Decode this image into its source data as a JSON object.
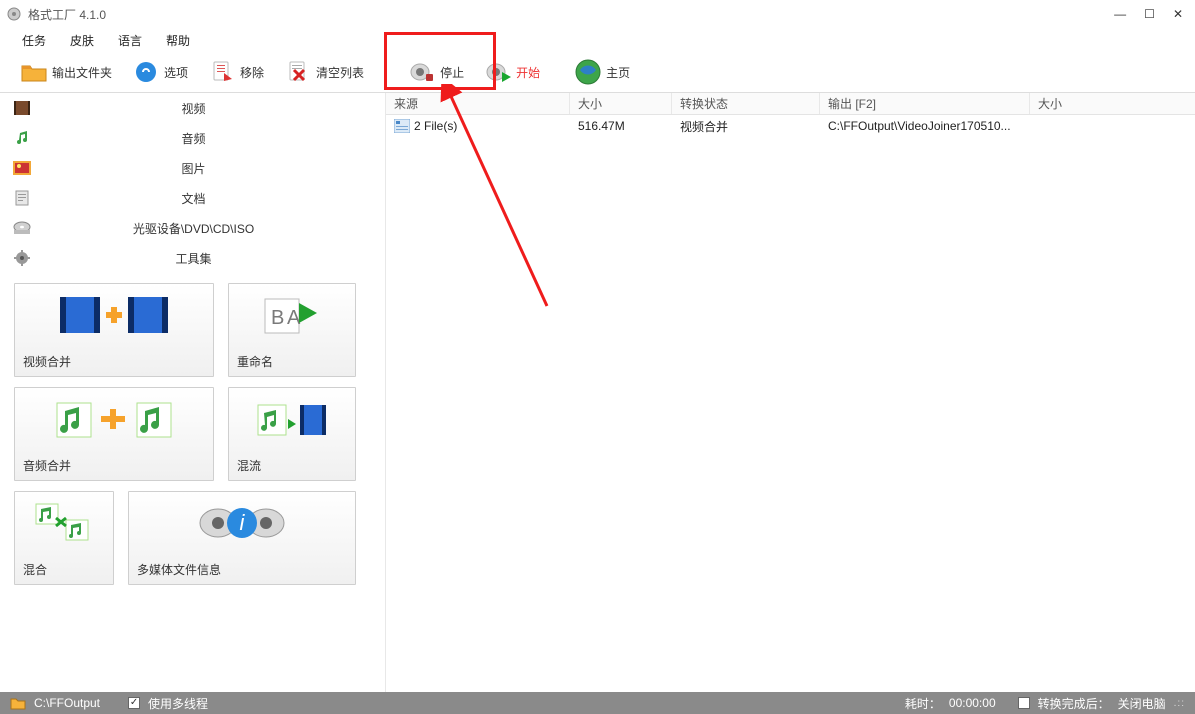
{
  "window": {
    "title": "格式工厂 4.1.0"
  },
  "menu": {
    "task": "任务",
    "skin": "皮肤",
    "lang": "语言",
    "help": "帮助"
  },
  "toolbar": {
    "output_folder": "输出文件夹",
    "options": "选项",
    "remove": "移除",
    "clear": "清空列表",
    "stop": "停止",
    "start": "开始",
    "home": "主页"
  },
  "categories": {
    "video": "视频",
    "audio": "音频",
    "picture": "图片",
    "document": "文档",
    "drive": "光驱设备\\DVD\\CD\\ISO",
    "toolkit": "工具集"
  },
  "tiles": {
    "video_join": "视频合并",
    "rename": "重命名",
    "audio_join": "音频合并",
    "mux": "混流",
    "mix": "混合",
    "media_info": "多媒体文件信息"
  },
  "table": {
    "headers": {
      "source": "来源",
      "size": "大小",
      "state": "转换状态",
      "output": "输出 [F2]",
      "size2": "大小"
    },
    "rows": [
      {
        "source": "2 File(s)",
        "size": "516.47M",
        "state": "视频合并",
        "output": "C:\\FFOutput\\VideoJoiner170510...",
        "size2": ""
      }
    ]
  },
  "statusbar": {
    "path": "C:\\FFOutput",
    "multithread": "使用多线程",
    "elapsed_label": "耗时：",
    "elapsed": "00:00:00",
    "after_label": "转换完成后：",
    "after_action": "关闭电脑"
  }
}
